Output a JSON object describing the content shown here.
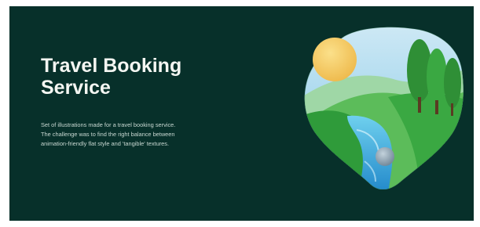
{
  "hero": {
    "title_lines": [
      "Travel Booking",
      "Service"
    ],
    "description_lines": [
      "Set of illustrations made for a travel booking service.",
      "The challenge was to find the right balance between",
      "animation-friendly flat style and 'tangible' textures."
    ]
  },
  "colors": {
    "background": "#07302a",
    "title": "#f4f6f2",
    "description": "#c9d8d2",
    "sun": "#f2c85b",
    "grass": "#2f9b3a",
    "water": "#3fa7d6"
  },
  "illustration": {
    "icon_name": "landscape-illustration-icon"
  }
}
